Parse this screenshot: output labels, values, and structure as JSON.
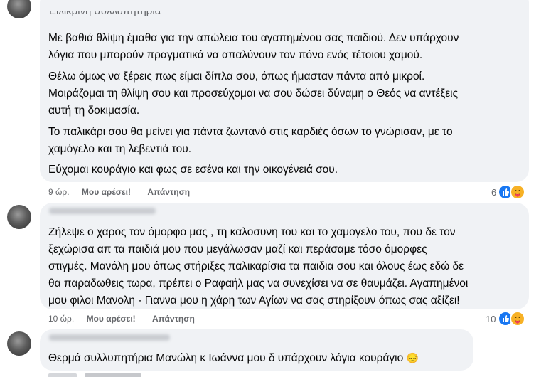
{
  "comments": [
    {
      "header_partial": "Ειλικρινή συλλυπητήρια",
      "paragraphs": [
        [
          "Με βαθιά θλίψη έμαθα για την απώλεια του αγαπημένου σας παιδιού. Δεν υπάρχουν",
          "λόγια που μπορούν πραγματικά να απαλύνουν τον πόνο ενός τέτοιου χαμού."
        ],
        [
          "Θέλω όμως να ξέρεις πως είμαι δίπλα σου, όπως ήμασταν πάντα από μικροί.",
          "Μοιράζομαι τη θλίψη σου και προσεύχομαι να σου δώσει δύναμη ο Θεός να αντέξεις",
          "αυτή τη δοκιμασία."
        ],
        [
          "Το παλικάρι σου θα μείνει για πάντα ζωντανό στις καρδιές όσων το γνώρισαν, με το",
          "χαμόγελο και τη λεβεντιά του."
        ],
        [
          "Εύχομαι κουράγιο και φως σε εσένα και την οικογένειά σου."
        ]
      ],
      "time": "9 ώρ.",
      "like_label": "Μου αρέσει!",
      "reply_label": "Απάντηση",
      "reaction_count": "6",
      "reactions": [
        "like-icon",
        "care-icon"
      ]
    },
    {
      "lines": [
        "Ζήλεψε ο χαρος τον όμορφο μας , τη καλοσυνη του και το χαμογελο του, που δε τον",
        "ξεχώρισα απ τα παιδιά μου που μεγάλωσαν μαζί και περάσαμε τόσο όμορφες",
        "στιγμές. Μανόλη μου όπως στήριξες παλικαρίσια τα παιδια σου και όλους έως εδώ δε",
        "θα παραδωθεις τωρα, πρέπει ο Ραφαήλ μας να συνεχίσει να σε θαυμάζει. Αγαπημένοι",
        "μου φιλοι Μανολη - Γιαννα μου η χάρη των Αγίων να σας στηρίξουν όπως σας αξίζει!"
      ],
      "time": "10 ώρ.",
      "like_label": "Μου αρέσει!",
      "reply_label": "Απάντηση",
      "reaction_count": "10",
      "reactions": [
        "like-icon",
        "care-icon"
      ]
    },
    {
      "text": "Θερμά συλλυπητήρια Μανώλη κ Ιωάννα μου δ υπάρχουν λόγια κουράγιο",
      "emoji": "😔"
    }
  ]
}
